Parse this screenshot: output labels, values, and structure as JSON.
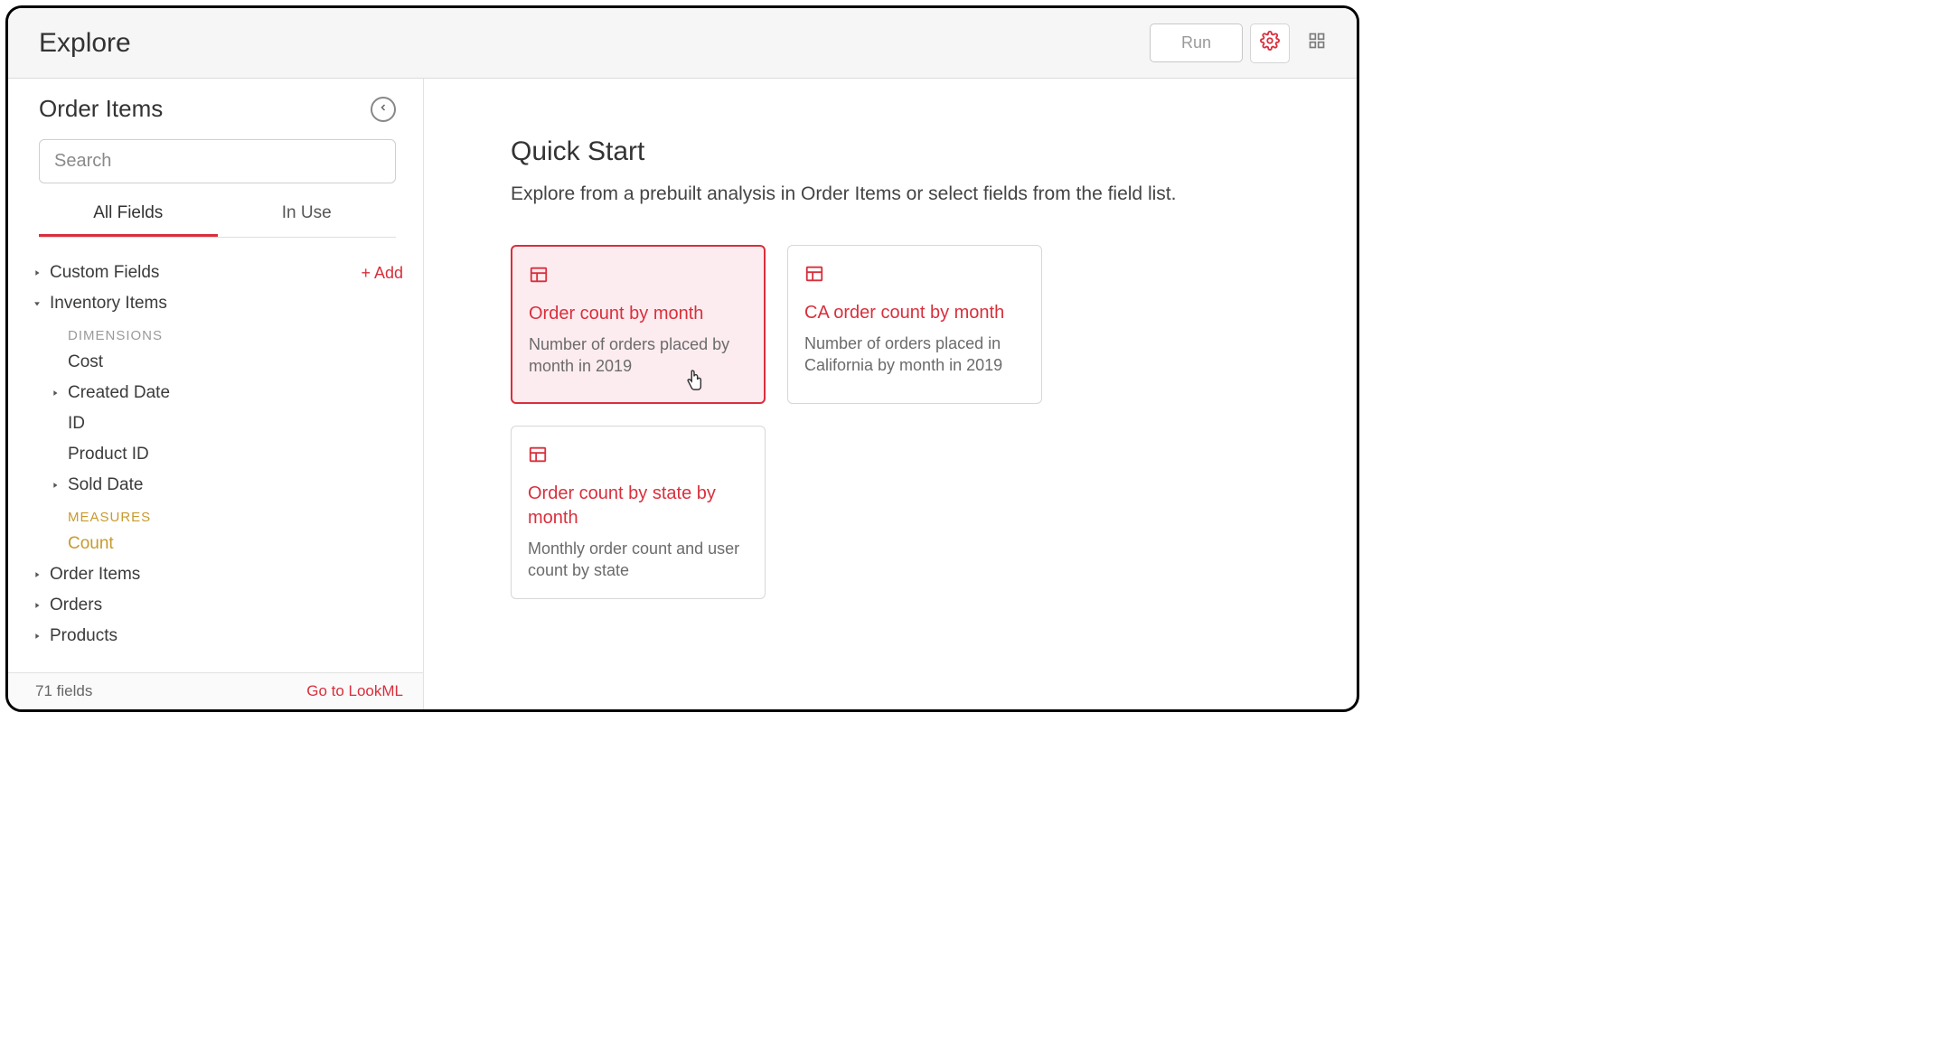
{
  "header": {
    "title": "Explore",
    "run_label": "Run"
  },
  "sidebar": {
    "title": "Order Items",
    "search_placeholder": "Search",
    "tabs": {
      "all": "All Fields",
      "in_use": "In Use"
    },
    "custom_fields": "Custom Fields",
    "add_label": "Add",
    "inventory_items": "Inventory Items",
    "dimensions_label": "DIMENSIONS",
    "fields": {
      "cost": "Cost",
      "created_date": "Created Date",
      "id": "ID",
      "product_id": "Product ID",
      "sold_date": "Sold Date"
    },
    "measures_label": "MEASURES",
    "measures": {
      "count": "Count"
    },
    "groups": {
      "order_items": "Order Items",
      "orders": "Orders",
      "products": "Products"
    },
    "footer": {
      "count": "71 fields",
      "link": "Go to LookML"
    }
  },
  "main": {
    "title": "Quick Start",
    "subtitle": "Explore from a prebuilt analysis in Order Items or select fields from the field list.",
    "cards": [
      {
        "title": "Order count by month",
        "desc": "Number of orders placed by month in 2019"
      },
      {
        "title": "CA order count by month",
        "desc": "Number of orders placed in California by month in 2019"
      },
      {
        "title": "Order count by state by month",
        "desc": "Monthly order count and user count by state"
      }
    ]
  }
}
